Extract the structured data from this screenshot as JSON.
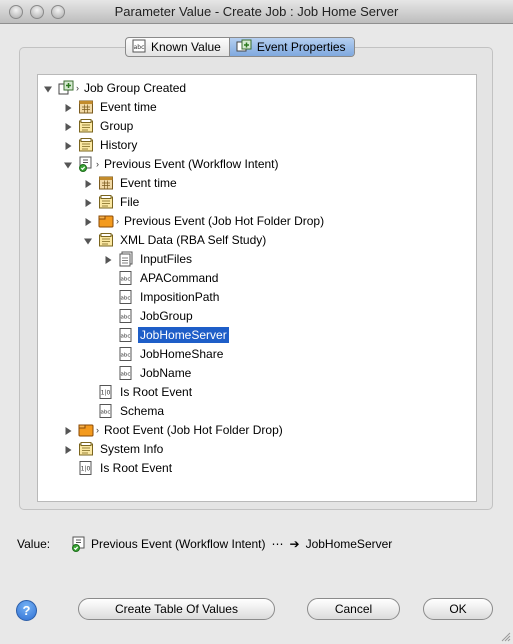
{
  "window": {
    "title": "Parameter Value - Create Job : Job Home Server"
  },
  "tabs": [
    {
      "label": "Known Value",
      "icon": "abc-icon",
      "active": false
    },
    {
      "label": "Event Properties",
      "icon": "event-properties-icon",
      "active": true
    }
  ],
  "tree": [
    {
      "label": "Job Group Created",
      "icon": "event-group-icon",
      "expanded": true,
      "level": 0,
      "chevron": true
    },
    {
      "label": "Event time",
      "icon": "calendar-icon",
      "expanded": false,
      "level": 1
    },
    {
      "label": "Group",
      "icon": "group-folder-icon",
      "expanded": false,
      "level": 1
    },
    {
      "label": "History",
      "icon": "history-folder-icon",
      "expanded": false,
      "level": 1
    },
    {
      "label": "Previous Event (Workflow Intent)",
      "icon": "workflow-intent-icon",
      "expanded": true,
      "level": 1,
      "chevron": true
    },
    {
      "label": "Event time",
      "icon": "calendar-icon",
      "expanded": false,
      "level": 2
    },
    {
      "label": "File",
      "icon": "file-folder-icon",
      "expanded": false,
      "level": 2
    },
    {
      "label": "Previous Event (Job Hot Folder Drop)",
      "icon": "hot-folder-icon",
      "expanded": false,
      "level": 2,
      "chevron": true
    },
    {
      "label": "XML Data (RBA Self Study)",
      "icon": "xml-data-icon",
      "expanded": true,
      "level": 2
    },
    {
      "label": "InputFiles",
      "icon": "list-icon",
      "expanded": false,
      "level": 3
    },
    {
      "label": "APACommand",
      "icon": "abc-icon",
      "level": 3,
      "leaf": true
    },
    {
      "label": "ImpositionPath",
      "icon": "abc-icon",
      "level": 3,
      "leaf": true
    },
    {
      "label": "JobGroup",
      "icon": "abc-icon",
      "level": 3,
      "leaf": true
    },
    {
      "label": "JobHomeServer",
      "icon": "abc-icon",
      "level": 3,
      "leaf": true,
      "selected": true
    },
    {
      "label": "JobHomeShare",
      "icon": "abc-icon",
      "level": 3,
      "leaf": true
    },
    {
      "label": "JobName",
      "icon": "abc-icon",
      "level": 3,
      "leaf": true
    },
    {
      "label": "Is Root Event",
      "icon": "boolean-icon",
      "level": 2,
      "leaf": true
    },
    {
      "label": "Schema",
      "icon": "abc-icon",
      "level": 2,
      "leaf": true
    },
    {
      "label": "Root Event (Job Hot Folder Drop)",
      "icon": "hot-folder-icon",
      "expanded": false,
      "level": 1,
      "chevron": true
    },
    {
      "label": "System Info",
      "icon": "system-folder-icon",
      "expanded": false,
      "level": 1
    },
    {
      "label": "Is Root Event",
      "icon": "boolean-icon",
      "level": 1,
      "leaf": true
    }
  ],
  "value": {
    "label": "Value:",
    "path_start": "Previous Event (Workflow Intent)",
    "ellipsis": "⋯",
    "arrow": "➔",
    "path_end": "JobHomeServer"
  },
  "buttons": {
    "help": "?",
    "create_table": "Create Table Of Values",
    "cancel": "Cancel",
    "ok": "OK"
  },
  "colors": {
    "selection": "#1e5ec8",
    "active_tab": "#7fa9df",
    "help_button": "#2f6fd3"
  }
}
